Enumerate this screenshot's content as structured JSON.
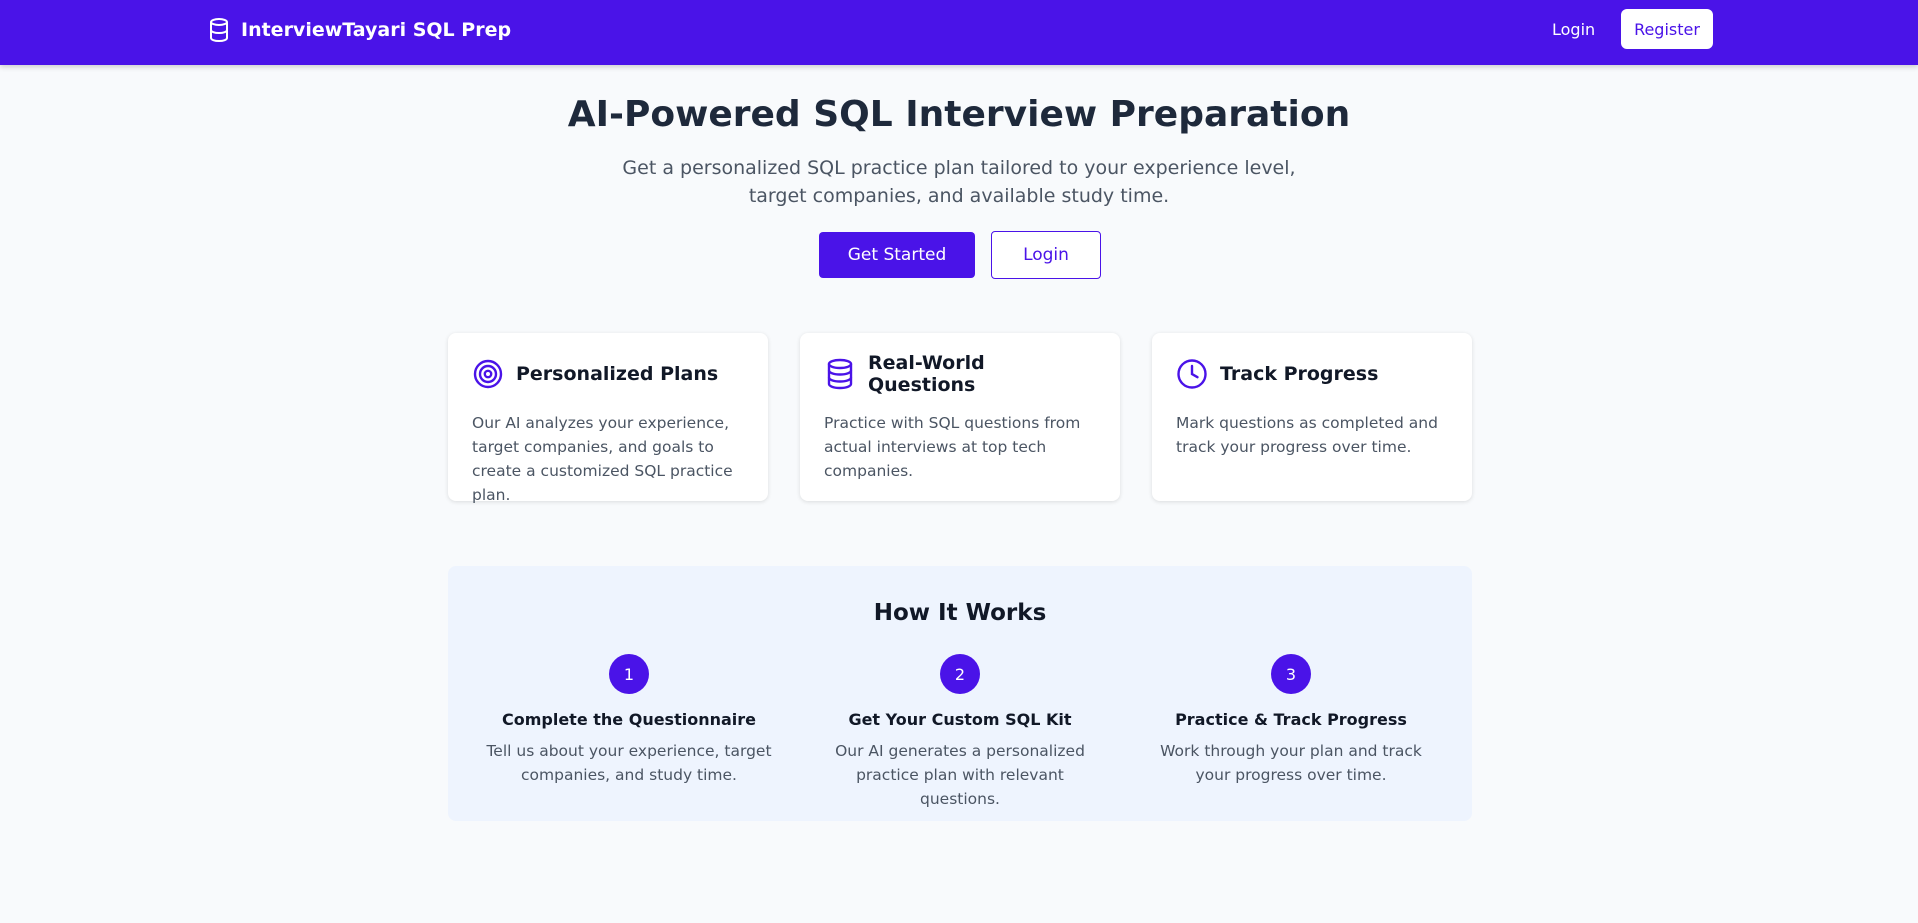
{
  "navbar": {
    "brand_icon": "database-icon",
    "brand_name": "InterviewTayari SQL Prep",
    "login_label": "Login",
    "register_label": "Register"
  },
  "hero": {
    "title": "AI-Powered SQL Interview Preparation",
    "subtitle": "Get a personalized SQL practice plan tailored to your experience level, target companies, and available study time.",
    "get_started_label": "Get Started",
    "login_label": "Login"
  },
  "features": [
    {
      "icon": "target-icon",
      "title": "Personalized Plans",
      "text": "Our AI analyzes your experience, target companies, and goals to create a customized SQL practice plan."
    },
    {
      "icon": "database-icon",
      "title": "Real-World Questions",
      "text": "Practice with SQL questions from actual interviews at top tech companies."
    },
    {
      "icon": "clock-icon",
      "title": "Track Progress",
      "text": "Mark questions as completed and track your progress over time."
    }
  ],
  "how_it_works": {
    "title": "How It Works",
    "steps": [
      {
        "number": "1",
        "title": "Complete the Questionnaire",
        "text": "Tell us about your experience, target companies, and study time."
      },
      {
        "number": "2",
        "title": "Get Your Custom SQL Kit",
        "text": "Our AI generates a personalized practice plan with relevant questions."
      },
      {
        "number": "3",
        "title": "Practice & Track Progress",
        "text": "Work through your plan and track your progress over time."
      }
    ]
  },
  "colors": {
    "brand": "#4a13e8",
    "page_background": "#f8fafc",
    "how_background": "#eef4fe"
  }
}
